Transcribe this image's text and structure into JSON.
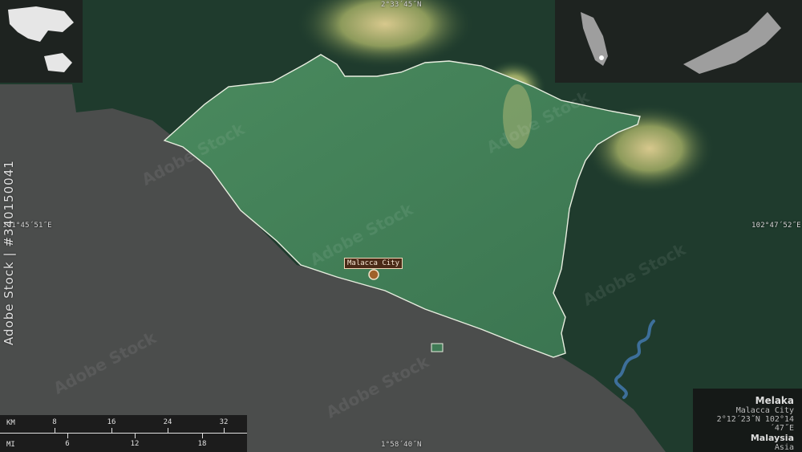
{
  "coords": {
    "top": "2°33´45˝N",
    "bottom": "1°58´40˝N",
    "left": "101°45´51˝E",
    "right": "102°47´52˝E"
  },
  "city": {
    "name": "Malacca City"
  },
  "watermark": {
    "vertical": "Adobe Stock | #340150041",
    "tile": "Adobe Stock"
  },
  "scale": {
    "km_unit": "KM",
    "mi_unit": "MI",
    "km_ticks": [
      "8",
      "16",
      "24",
      "32"
    ],
    "mi_ticks": [
      "6",
      "12",
      "18"
    ]
  },
  "info": {
    "region": "Melaka",
    "capital": "Malacca City",
    "coordinates": "2°12´23˝N 102°14´47˝E",
    "country": "Malaysia",
    "continent": "Asia"
  },
  "colors": {
    "sea": "#4a4c4b",
    "land_dark": "#1d3a2c",
    "region_fill": "#3f7a55",
    "region_border": "#e8eee0",
    "river": "#3d6f9a",
    "city_marker": "#a0612a"
  }
}
